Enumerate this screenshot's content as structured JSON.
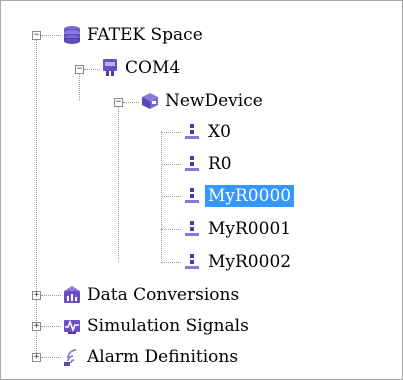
{
  "tree": {
    "root": {
      "label": "FATEK Space",
      "icon": "database-icon",
      "port": {
        "label": "COM4",
        "icon": "serial-port-icon",
        "device": {
          "label": "NewDevice",
          "icon": "device-box-icon",
          "tags": [
            {
              "label": "X0",
              "icon": "tag-icon",
              "selected": false
            },
            {
              "label": "R0",
              "icon": "tag-icon",
              "selected": false
            },
            {
              "label": "MyR0000",
              "icon": "tag-icon",
              "selected": true
            },
            {
              "label": "MyR0001",
              "icon": "tag-icon",
              "selected": false
            },
            {
              "label": "MyR0002",
              "icon": "tag-icon",
              "selected": false
            }
          ]
        }
      }
    },
    "sections": [
      {
        "label": "Data Conversions",
        "icon": "data-conversion-icon"
      },
      {
        "label": "Simulation Signals",
        "icon": "simulation-signal-icon"
      },
      {
        "label": "Alarm Definitions",
        "icon": "alarm-icon"
      }
    ],
    "expander": {
      "expanded": "−",
      "collapsed": "+"
    }
  }
}
